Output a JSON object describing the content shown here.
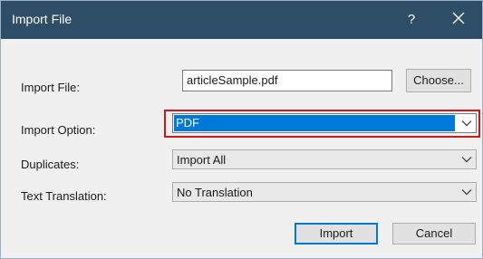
{
  "window": {
    "title": "Import File",
    "help_glyph": "?",
    "close_icon": "close-icon"
  },
  "form": {
    "import_file": {
      "label": "Import File:",
      "value": "articleSample.pdf",
      "choose_label": "Choose..."
    },
    "import_option": {
      "label": "Import Option:",
      "value": "PDF",
      "highlighted": true
    },
    "duplicates": {
      "label": "Duplicates:",
      "value": "Import All"
    },
    "text_translation": {
      "label": "Text Translation:",
      "value": "No Translation"
    }
  },
  "buttons": {
    "import_label": "Import",
    "cancel_label": "Cancel"
  },
  "colors": {
    "titlebar": "#2e4d67",
    "selection": "#0078d7",
    "highlight_frame": "#c8191f",
    "dialog_bg": "#f0f0f0"
  }
}
